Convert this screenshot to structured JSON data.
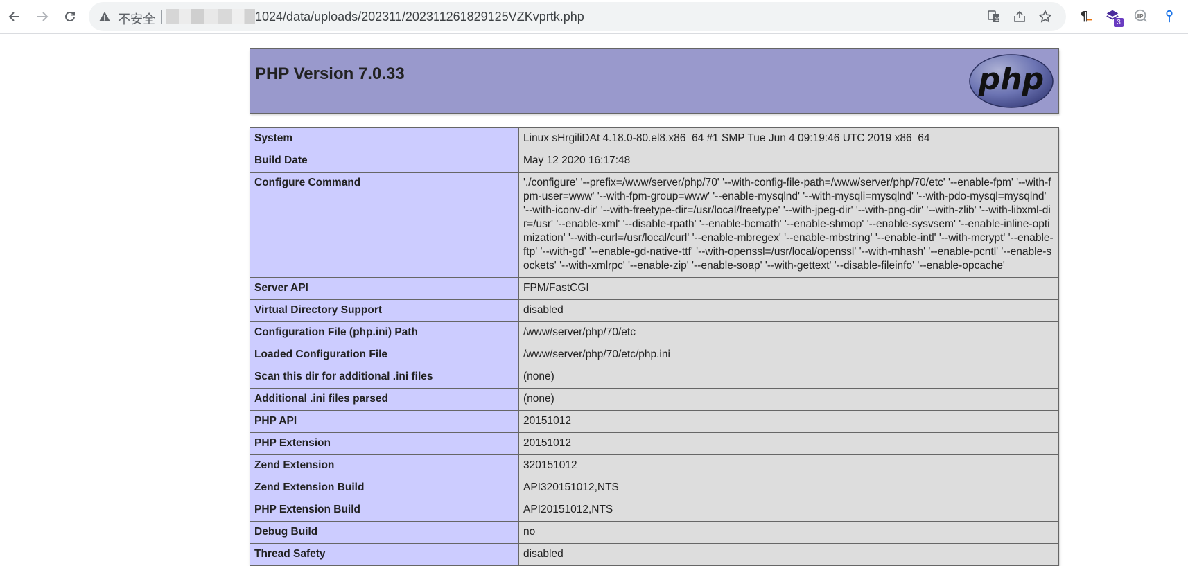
{
  "browser": {
    "insecure_label": "不安全",
    "url_visible": "1024/data/uploads/202311/202311261829125VZKvprtk.php",
    "extension_badge": "3"
  },
  "icons": {
    "back": "back-arrow-icon",
    "forward": "forward-arrow-icon",
    "reload": "reload-icon",
    "warning": "warning-icon",
    "translate": "translate-icon",
    "share": "share-icon",
    "bookmark": "star-icon",
    "ext1": "pilcrow-icon",
    "ext2": "stack-icon",
    "ext3": "ip-icon",
    "ext4": "pin-icon"
  },
  "colors": {
    "header_bg": "#9999cc",
    "key_bg": "#ccccff",
    "value_bg": "#dddddd"
  },
  "page": {
    "title": "PHP Version 7.0.33",
    "logo_text": "php",
    "rows": [
      {
        "key": "System",
        "value": "Linux sHrgiliDAt 4.18.0-80.el8.x86_64 #1 SMP Tue Jun 4 09:19:46 UTC 2019 x86_64"
      },
      {
        "key": "Build Date",
        "value": "May 12 2020 16:17:48"
      },
      {
        "key": "Configure Command",
        "value": "'./configure' '--prefix=/www/server/php/70' '--with-config-file-path=/www/server/php/70/etc' '--enable-fpm' '--with-fpm-user=www' '--with-fpm-group=www' '--enable-mysqlnd' '--with-mysqli=mysqlnd' '--with-pdo-mysql=mysqlnd' '--with-iconv-dir' '--with-freetype-dir=/usr/local/freetype' '--with-jpeg-dir' '--with-png-dir' '--with-zlib' '--with-libxml-dir=/usr' '--enable-xml' '--disable-rpath' '--enable-bcmath' '--enable-shmop' '--enable-sysvsem' '--enable-inline-optimization' '--with-curl=/usr/local/curl' '--enable-mbregex' '--enable-mbstring' '--enable-intl' '--with-mcrypt' '--enable-ftp' '--with-gd' '--enable-gd-native-ttf' '--with-openssl=/usr/local/openssl' '--with-mhash' '--enable-pcntl' '--enable-sockets' '--with-xmlrpc' '--enable-zip' '--enable-soap' '--with-gettext' '--disable-fileinfo' '--enable-opcache'"
      },
      {
        "key": "Server API",
        "value": "FPM/FastCGI"
      },
      {
        "key": "Virtual Directory Support",
        "value": "disabled"
      },
      {
        "key": "Configuration File (php.ini) Path",
        "value": "/www/server/php/70/etc"
      },
      {
        "key": "Loaded Configuration File",
        "value": "/www/server/php/70/etc/php.ini"
      },
      {
        "key": "Scan this dir for additional .ini files",
        "value": "(none)"
      },
      {
        "key": "Additional .ini files parsed",
        "value": "(none)"
      },
      {
        "key": "PHP API",
        "value": "20151012"
      },
      {
        "key": "PHP Extension",
        "value": "20151012"
      },
      {
        "key": "Zend Extension",
        "value": "320151012"
      },
      {
        "key": "Zend Extension Build",
        "value": "API320151012,NTS"
      },
      {
        "key": "PHP Extension Build",
        "value": "API20151012,NTS"
      },
      {
        "key": "Debug Build",
        "value": "no"
      },
      {
        "key": "Thread Safety",
        "value": "disabled"
      }
    ]
  }
}
